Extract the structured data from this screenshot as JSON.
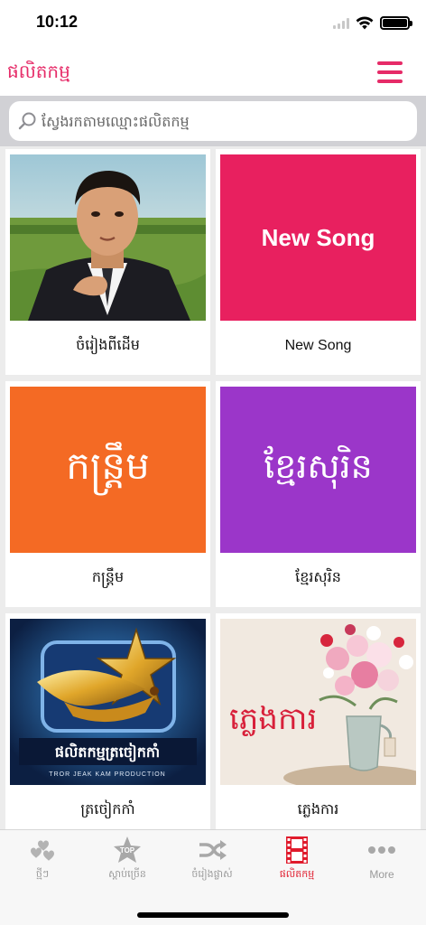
{
  "status_bar": {
    "time": "10:12"
  },
  "nav": {
    "title": "ផលិតកម្ម",
    "menu_icon": "hamburger-menu-icon"
  },
  "search": {
    "placeholder": "ស្វែងរកតាមឈ្មោះផលិតកម្ម"
  },
  "grid": {
    "items": [
      {
        "label": "ចំរៀងពីដើម",
        "image": "vintage-singer-portrait"
      },
      {
        "label": "New Song",
        "tile_text": "New Song",
        "tile_color": "#e8205f"
      },
      {
        "label": "កន្រ្តឹម",
        "tile_text": "កន្រ្តឹម",
        "tile_color": "#f46a24"
      },
      {
        "label": "ខ្មែរសុរិន",
        "tile_text": "ខ្មែរសុរិន",
        "tile_color": "#9b36c9"
      },
      {
        "label": "ត្រចៀកកាំ",
        "image": "tror-jeak-kam-production-logo",
        "logo_text": "ផលិតកម្មត្រចៀកកាំ",
        "logo_subtext": "TROR JEAK KAM PRODUCTION"
      },
      {
        "label": "ភ្លេងការ",
        "image": "flower-vase",
        "overlay_text": "ភ្លេងការ",
        "overlay_color": "#d8203a"
      }
    ]
  },
  "tab_bar": {
    "tabs": [
      {
        "label": "ថ្មីៗ",
        "icon": "hearts-icon",
        "active": false
      },
      {
        "label": "ស្តាប់ច្រើន",
        "icon": "top-star-icon",
        "active": false
      },
      {
        "label": "ចំរៀងផ្លាស់",
        "icon": "shuffle-icon",
        "active": false
      },
      {
        "label": "ផលិតកម្ម",
        "icon": "film-strip-icon",
        "active": true
      },
      {
        "label": "More",
        "icon": "more-dots-icon",
        "active": false
      }
    ],
    "active_color": "#e01b2c",
    "inactive_color": "#9a9a9a"
  },
  "colors": {
    "accent": "#e62b68",
    "tile_pink": "#e8205f",
    "tile_orange": "#f46a24",
    "tile_purple": "#9b36c9"
  }
}
